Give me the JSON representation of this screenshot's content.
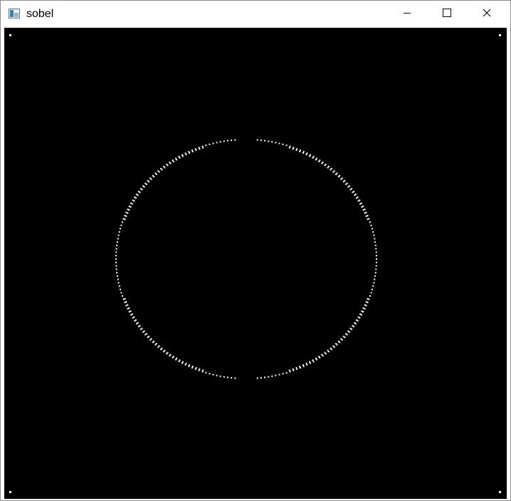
{
  "window": {
    "title": "sobel",
    "controls": {
      "minimize": "minimize-icon",
      "maximize": "maximize-icon",
      "close": "close-icon"
    }
  },
  "image": {
    "background": "#000000",
    "edge_color": "#ffffff"
  }
}
